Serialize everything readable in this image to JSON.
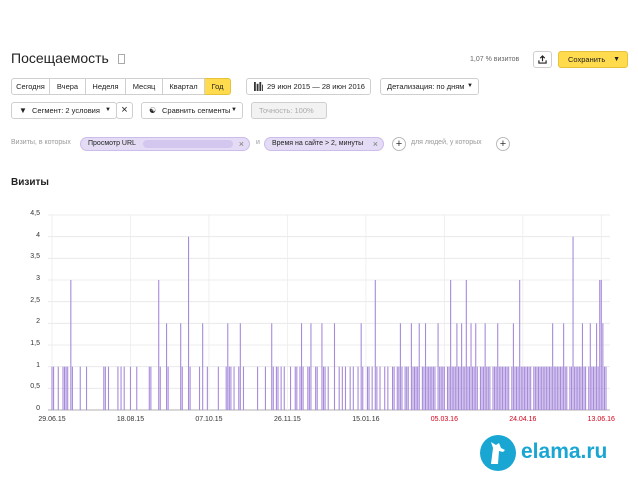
{
  "header": {
    "title": "Посещаемость",
    "share": "1,07 % визитов",
    "save_label": "Сохранить"
  },
  "periods": [
    {
      "label": "Сегодня",
      "active": false
    },
    {
      "label": "Вчера",
      "active": false
    },
    {
      "label": "Неделя",
      "active": false
    },
    {
      "label": "Месяц",
      "active": false
    },
    {
      "label": "Квартал",
      "active": false
    },
    {
      "label": "Год",
      "active": true
    }
  ],
  "date_range": "29 июн 2015 — 28 июн 2016",
  "detail": "Детализация: по дням",
  "segment": "Сегмент: 2 условия",
  "compare": "Сравнить сегменты",
  "accuracy": "Точность: 100%",
  "filters": {
    "prefix": "Визиты, в которых",
    "cond1": "Просмотр URL",
    "joiner": "и",
    "cond2": "Время на сайте > 2, минуты",
    "suffix": "для людей, у которых"
  },
  "section_title": "Визиты",
  "colors": {
    "accent": "#ffdb4d",
    "bars": "#a78bdb",
    "weekend": "#d0021b"
  },
  "watermark": {
    "text": "elama.ru",
    "icon": "llama-logo-icon"
  },
  "chart_data": {
    "type": "bar",
    "title": "",
    "xlabel": "",
    "ylabel": "",
    "ylim": [
      0,
      4.5
    ],
    "yticks": [
      "0",
      "0,5",
      "1",
      "1,5",
      "2",
      "2,5",
      "3",
      "3,5",
      "4",
      "4,5"
    ],
    "x_range": [
      "29.06.15",
      "28.06.16"
    ],
    "xticks": [
      {
        "label": "29.06.15",
        "day": 0,
        "red": false
      },
      {
        "label": "18.08.15",
        "day": 50,
        "red": false
      },
      {
        "label": "07.10.15",
        "day": 100,
        "red": false
      },
      {
        "label": "26.11.15",
        "day": 150,
        "red": false
      },
      {
        "label": "15.01.16",
        "day": 200,
        "red": false
      },
      {
        "label": "05.03.16",
        "day": 250,
        "red": true
      },
      {
        "label": "24.04.16",
        "day": 300,
        "red": true
      },
      {
        "label": "13.06.16",
        "day": 350,
        "red": true
      }
    ],
    "series": [
      {
        "values": [
          1,
          1,
          0,
          0,
          1,
          0,
          0,
          1,
          1,
          1,
          1,
          0,
          3,
          1,
          0,
          0,
          0,
          0,
          1,
          0,
          0,
          0,
          1,
          0,
          0,
          0,
          0,
          0,
          0,
          0,
          0,
          0,
          0,
          1,
          1,
          0,
          1,
          0,
          0,
          0,
          0,
          0,
          1,
          0,
          1,
          0,
          1,
          0,
          0,
          0,
          1,
          0,
          0,
          0,
          1,
          0,
          0,
          0,
          0,
          0,
          0,
          0,
          1,
          1,
          0,
          0,
          0,
          0,
          3,
          1,
          0,
          0,
          0,
          2,
          1,
          0,
          0,
          0,
          0,
          0,
          0,
          0,
          2,
          1,
          0,
          0,
          0,
          4,
          1,
          0,
          0,
          0,
          0,
          0,
          1,
          0,
          2,
          0,
          0,
          1,
          0,
          0,
          0,
          0,
          0,
          0,
          1,
          0,
          0,
          0,
          0,
          1,
          2,
          1,
          1,
          0,
          1,
          0,
          0,
          1,
          2,
          0,
          1,
          0,
          0,
          0,
          0,
          0,
          0,
          0,
          0,
          1,
          0,
          0,
          0,
          0,
          1,
          0,
          0,
          0,
          2,
          1,
          0,
          1,
          1,
          0,
          1,
          0,
          1,
          0,
          0,
          0,
          1,
          0,
          0,
          1,
          1,
          0,
          1,
          2,
          1,
          0,
          0,
          1,
          1,
          2,
          0,
          0,
          1,
          1,
          0,
          0,
          2,
          1,
          1,
          0,
          1,
          0,
          0,
          0,
          2,
          0,
          0,
          1,
          0,
          1,
          0,
          1,
          0,
          0,
          1,
          0,
          1,
          0,
          0,
          1,
          0,
          2,
          1,
          0,
          0,
          1,
          1,
          0,
          1,
          0,
          3,
          1,
          0,
          1,
          0,
          0,
          1,
          0,
          1,
          0,
          0,
          1,
          1,
          0,
          1,
          1,
          2,
          1,
          0,
          1,
          1,
          1,
          0,
          2,
          1,
          1,
          1,
          1,
          2,
          0,
          1,
          1,
          2,
          1,
          1,
          1,
          1,
          1,
          1,
          0,
          2,
          1,
          1,
          1,
          1,
          0,
          1,
          1,
          3,
          1,
          1,
          1,
          2,
          1,
          1,
          2,
          1,
          1,
          3,
          1,
          1,
          2,
          1,
          1,
          2,
          1,
          0,
          1,
          1,
          1,
          2,
          1,
          1,
          1,
          0,
          1,
          1,
          1,
          2,
          1,
          1,
          1,
          1,
          1,
          1,
          1,
          0,
          1,
          2,
          1,
          1,
          1,
          3,
          1,
          1,
          1,
          1,
          1,
          1,
          1,
          0,
          1,
          1,
          1,
          1,
          1,
          1,
          1,
          1,
          1,
          1,
          1,
          1,
          2,
          1,
          1,
          1,
          1,
          1,
          1,
          2,
          1,
          1,
          0,
          1,
          1,
          4,
          1,
          1,
          1,
          1,
          1,
          2,
          1,
          1,
          0,
          1,
          2,
          1,
          1,
          1,
          2,
          1,
          3,
          3,
          2,
          1,
          1
        ]
      }
    ]
  }
}
